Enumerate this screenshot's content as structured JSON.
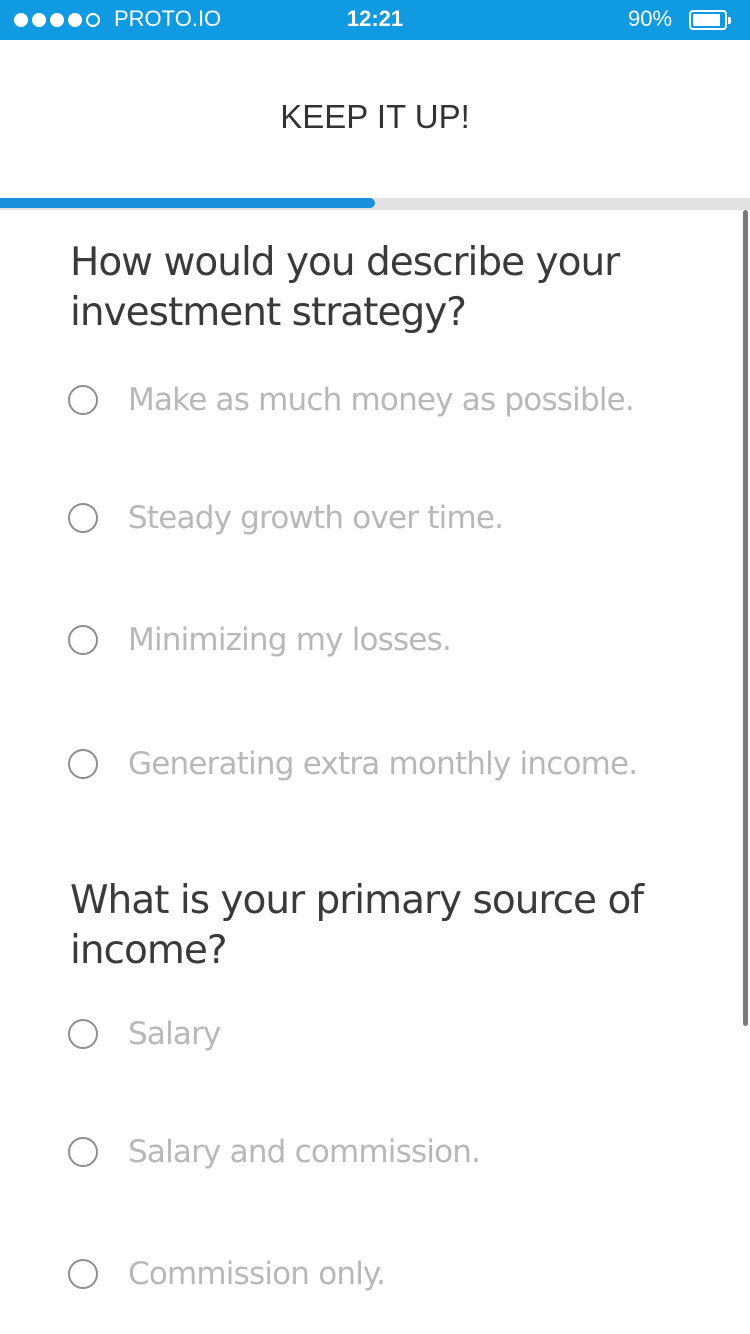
{
  "status_bar": {
    "carrier": "PROTO.IO",
    "time": "12:21",
    "battery_percent": "90%",
    "battery_level": 0.9,
    "signal_bars": [
      true,
      true,
      true,
      true,
      false
    ],
    "background_color": "#0f9ae2"
  },
  "header": {
    "title": "KEEP IT UP!"
  },
  "progress": {
    "value": 0.5,
    "fill_color": "#1a8fdb",
    "track_color": "#e2e2e2"
  },
  "questions": [
    {
      "text": "How would you describe your investment strategy?",
      "options": [
        "Make as much money as possible.",
        "Steady growth over time.",
        "Minimizing my losses.",
        "Generating extra monthly income."
      ]
    },
    {
      "text": "What is your primary source of income?",
      "options": [
        "Salary",
        "Salary and commission.",
        "Commission only."
      ]
    }
  ]
}
